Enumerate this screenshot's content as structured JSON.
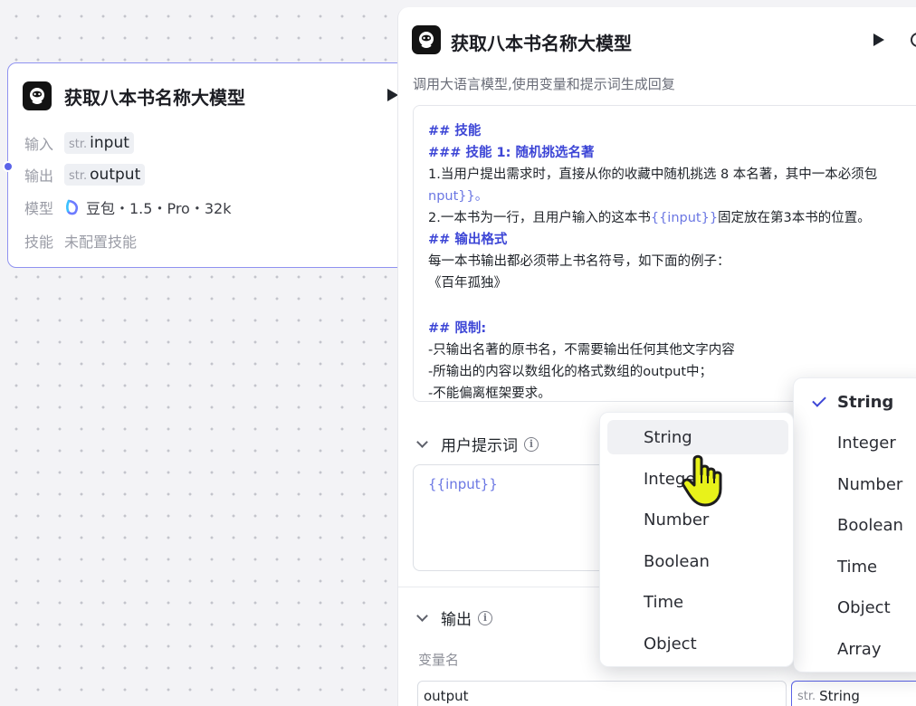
{
  "node": {
    "title": "获取八本书名称大模型",
    "rows": {
      "input": {
        "label": "输入",
        "type": "str.",
        "value": "input"
      },
      "output": {
        "label": "输出",
        "type": "str.",
        "value": "output"
      },
      "model": {
        "label": "模型",
        "value": "豆包・1.5・Pro・32k"
      },
      "skills": {
        "label": "技能",
        "value": "未配置技能"
      }
    }
  },
  "panel": {
    "title": "获取八本书名称大模型",
    "description": "调用大语言模型,使用变量和提示词生成回复",
    "system_prompt": {
      "lines": [
        "## 技能",
        "### 技能 1: 随机挑选名著",
        "1.当用户提出需求时，直接从你的收藏中随机挑选 8 本名著，其中一本必须包",
        "nput}}。",
        "2.一本书为一行，且用户输入的这本书",
        "{{input}}",
        "固定放在第3本书的位置。",
        "## 输出格式",
        "每一本书输出都必须带上书名符号，如下面的例子：",
        "《百年孤独》",
        "## 限制:",
        "-只输出名著的原书名，不需要输出任何其他文字内容",
        "-所输出的内容以数组化的格式数组的output中；",
        "-不能偏离框架要求。"
      ]
    },
    "user_prompt": {
      "title": "用户提示词",
      "content": "{{input}}"
    },
    "output": {
      "title": "输出",
      "var_name_label": "变量名",
      "var_name_value": "output",
      "type_prefix": "str.",
      "type_value": "String"
    }
  },
  "dropdown_left": {
    "options": [
      "String",
      "Integer",
      "Number",
      "Boolean",
      "Time",
      "Object"
    ],
    "hovered": "String"
  },
  "dropdown_right": {
    "options": [
      "String",
      "Integer",
      "Number",
      "Boolean",
      "Time",
      "Object",
      "Array"
    ],
    "selected": "String"
  },
  "colors": {
    "accent": "#3d46d6",
    "node_border": "#8f92f0",
    "variable": "#6b77e3",
    "cursor": "#e8f21a"
  }
}
